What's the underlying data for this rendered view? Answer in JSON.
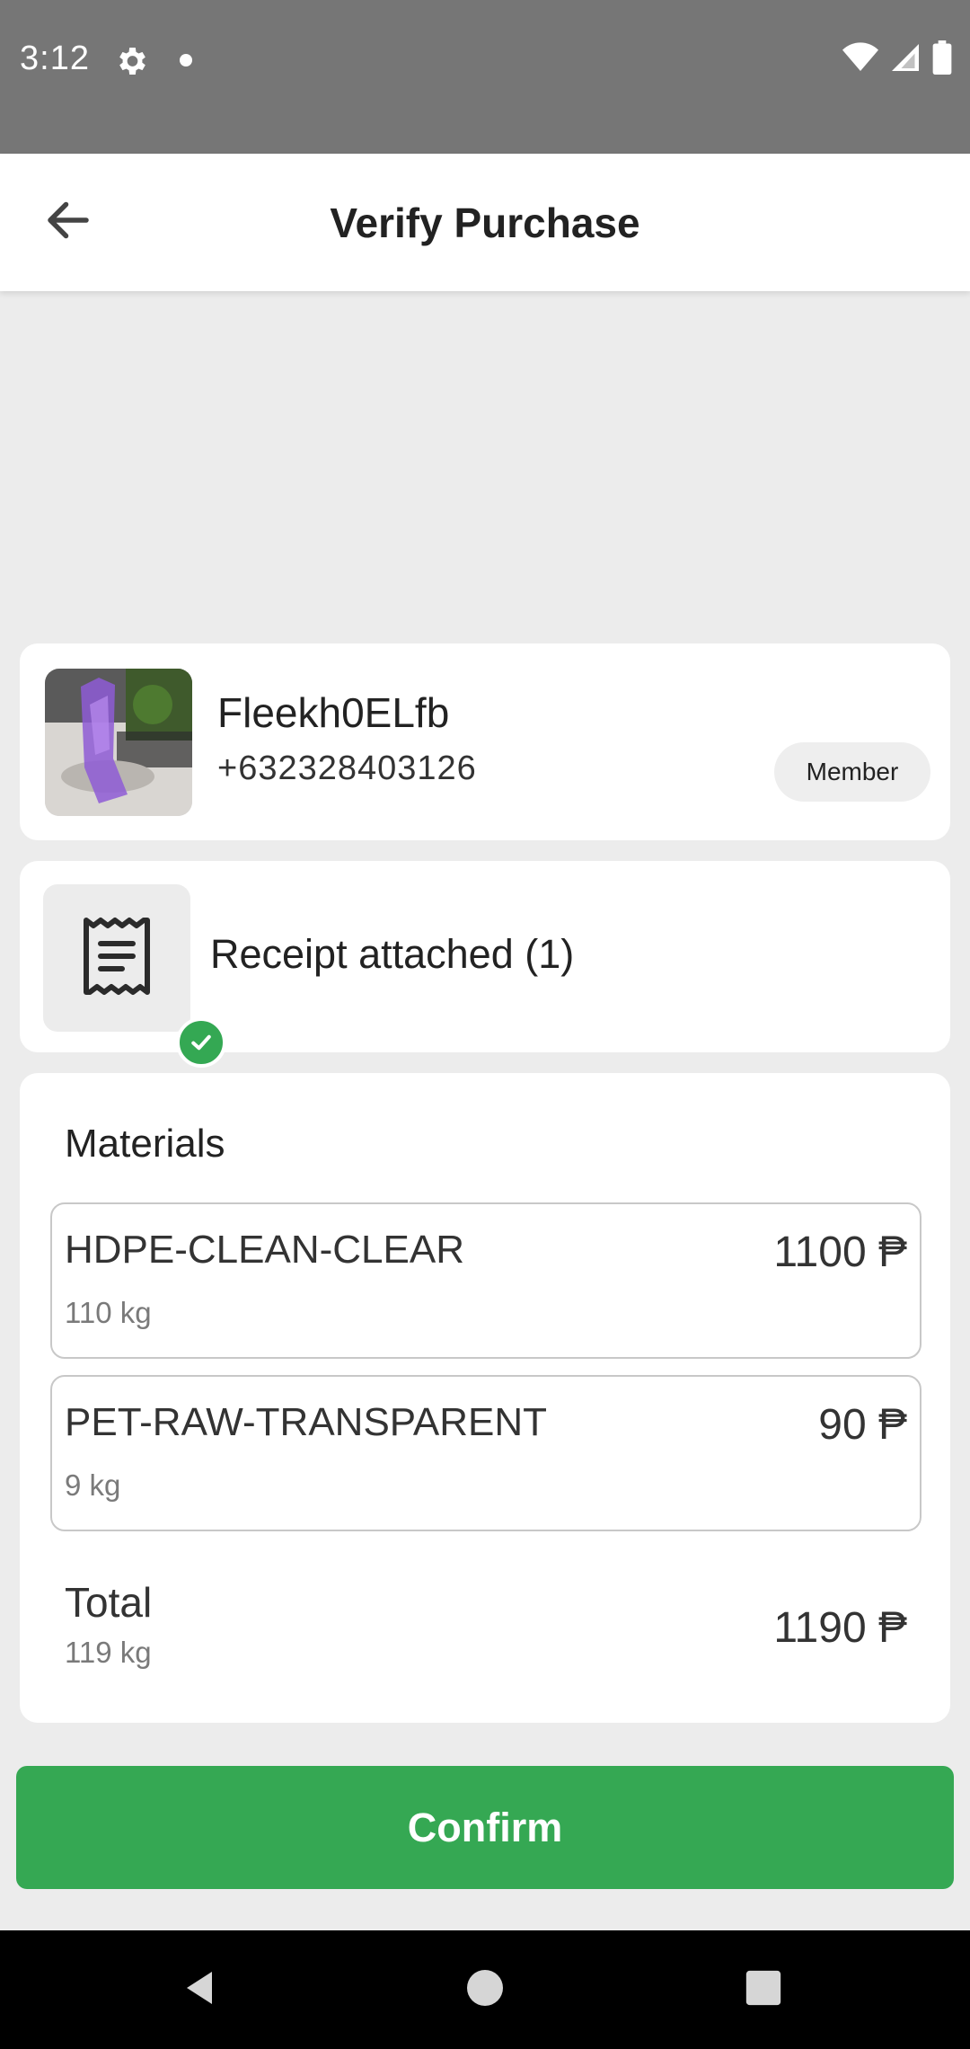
{
  "status_bar": {
    "time": "3:12"
  },
  "app_bar": {
    "title": "Verify Purchase"
  },
  "member": {
    "name": "Fleekh0ELfb",
    "phone": "+632328403126",
    "badge": "Member"
  },
  "receipt": {
    "label": "Receipt attached (1)"
  },
  "materials": {
    "title": "Materials",
    "items": [
      {
        "name": "HDPE-CLEAN-CLEAR",
        "weight": "110 kg",
        "price": "1100 ₱"
      },
      {
        "name": "PET-RAW-TRANSPARENT",
        "weight": "9 kg",
        "price": "90 ₱"
      }
    ],
    "total": {
      "label": "Total",
      "weight": "119 kg",
      "price": "1190 ₱"
    }
  },
  "actions": {
    "confirm_label": "Confirm"
  },
  "colors": {
    "accent": "#35a853",
    "status_bar": "#767676"
  },
  "icons": [
    "settings-gear-icon",
    "wifi-icon",
    "signal-icon",
    "battery-icon",
    "back-arrow-icon",
    "receipt-icon",
    "check-icon",
    "nav-back-icon",
    "nav-home-icon",
    "nav-recents-icon"
  ]
}
